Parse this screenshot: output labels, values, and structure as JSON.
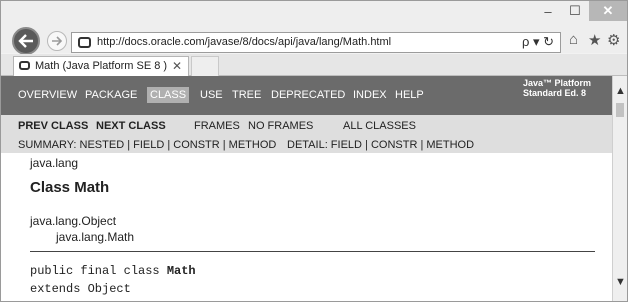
{
  "window": {
    "minimize": "–",
    "maximize": "☐",
    "close": "✕"
  },
  "browser": {
    "url": "http://docs.oracle.com/javase/8/docs/api/java/lang/Math.html",
    "address_tools": "ρ ▾ ↻",
    "tab_title": "Math (Java Platform SE 8 )",
    "tab_close": "✕",
    "home_icon": "home-icon",
    "favorites_icon": "star-icon",
    "settings_icon": "gear-icon"
  },
  "topnav": {
    "items": [
      "OVERVIEW",
      "PACKAGE",
      "CLASS",
      "USE",
      "TREE",
      "DEPRECATED",
      "INDEX",
      "HELP"
    ],
    "active": "CLASS",
    "platform_line1": "Java™ Platform",
    "platform_line2": "Standard Ed. 8"
  },
  "subnav": {
    "prev_class": "PREV CLASS",
    "next_class": "NEXT CLASS",
    "frames": "FRAMES",
    "no_frames": "NO FRAMES",
    "all_classes": "ALL CLASSES",
    "summary": "SUMMARY: NESTED | FIELD | CONSTR | METHOD",
    "detail": "DETAIL: FIELD | CONSTR | METHOD"
  },
  "page": {
    "package": "java.lang",
    "class_title": "Class Math",
    "inheritance_parent": "java.lang.Object",
    "inheritance_child": "java.lang.Math",
    "decl_prefix": "public final class ",
    "decl_name": "Math",
    "extends_line": "extends Object"
  },
  "scrollbar": {
    "up": "▲",
    "down": "▼"
  }
}
